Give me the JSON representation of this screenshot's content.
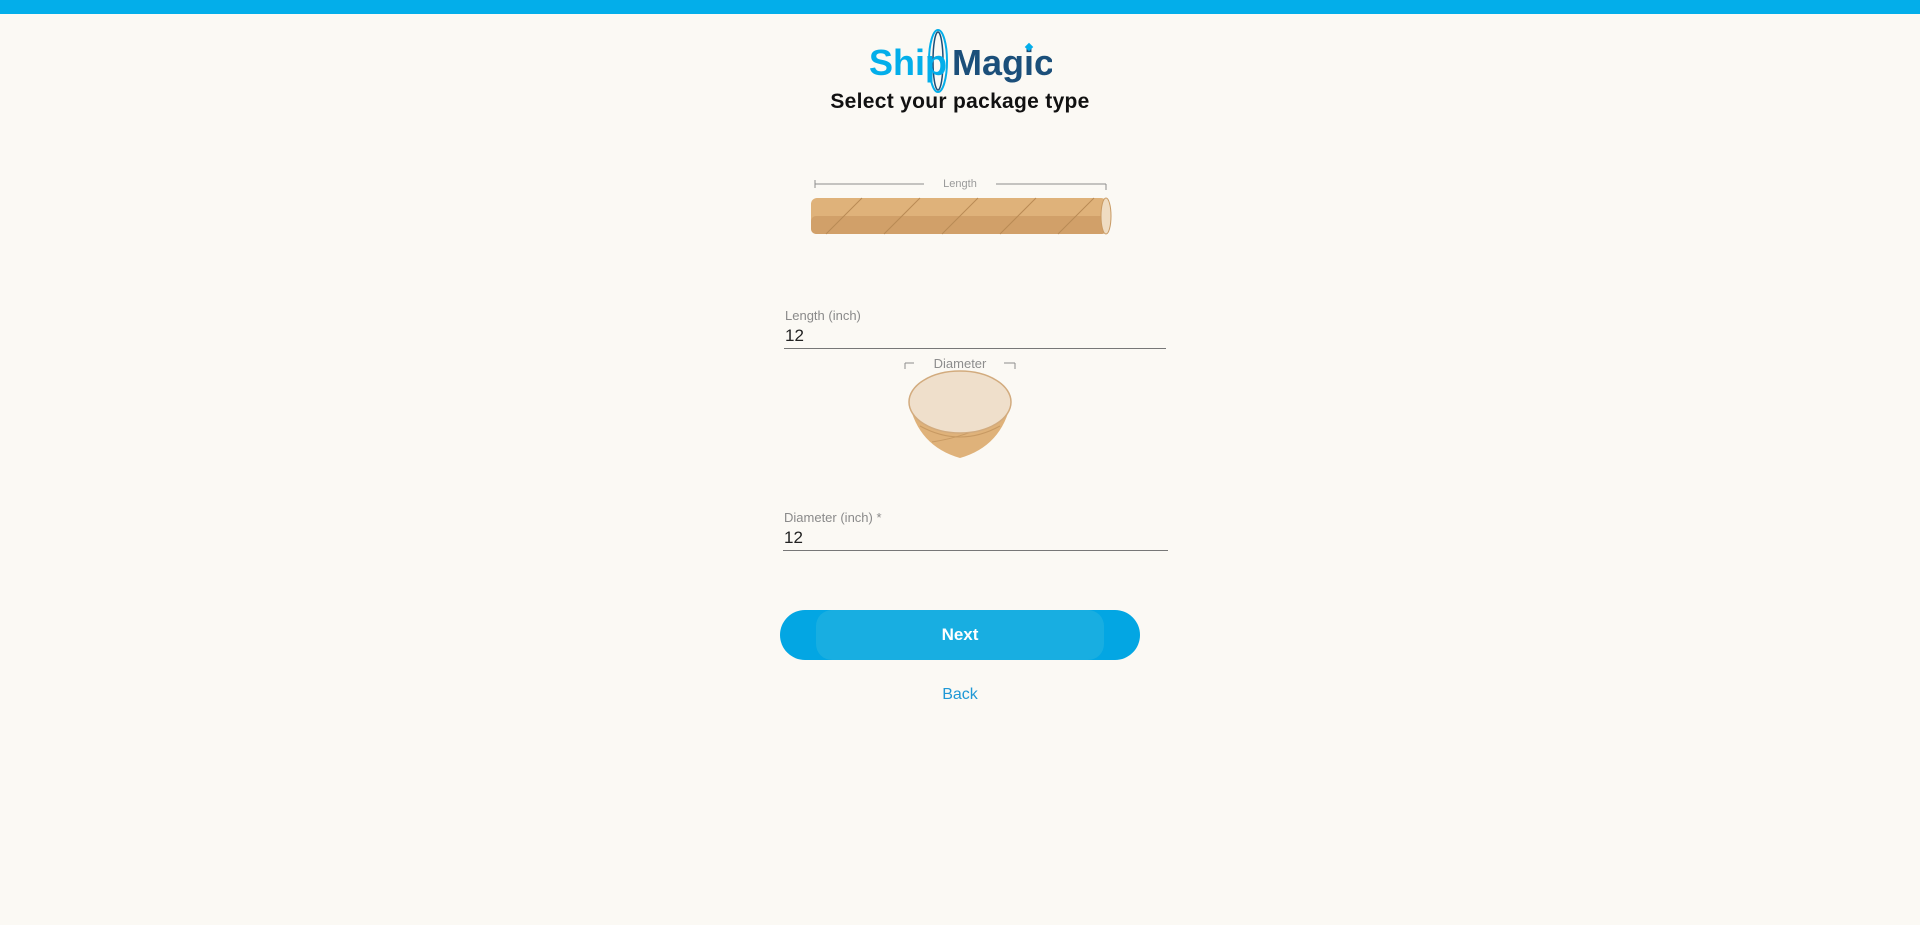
{
  "brand": {
    "part1": "Ship",
    "part2": "Magic",
    "primary_color": "#03aeea",
    "secondary_color": "#1b4f7a"
  },
  "page": {
    "title": "Select your package type"
  },
  "tube_image": {
    "dimension_label": "Length"
  },
  "length_field": {
    "label": "Length (inch)",
    "value": "12"
  },
  "cup_image": {
    "dimension_label": "Diameter"
  },
  "diameter_field": {
    "label": "Diameter (inch) *",
    "value": "12"
  },
  "actions": {
    "next_label": "Next",
    "back_label": "Back"
  },
  "colors": {
    "accent": "#03aeea",
    "button": "#03a6e3",
    "link": "#1f98d6",
    "background": "#fbf9f4"
  }
}
